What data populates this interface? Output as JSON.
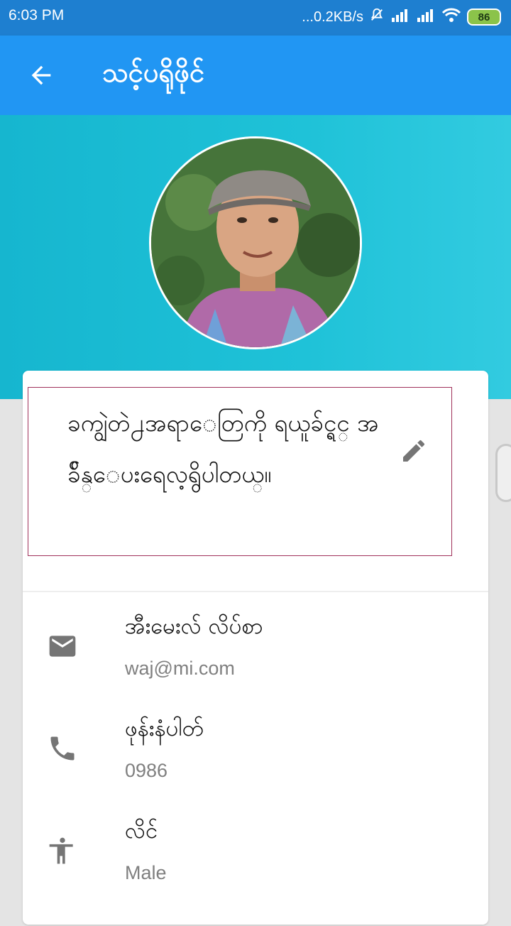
{
  "status_bar": {
    "time": "6:03 PM",
    "net_speed": "...0.2KB/s",
    "battery": "86"
  },
  "app_bar": {
    "title": "သင့်ပရိုဖိုင်"
  },
  "profile": {
    "bio": "ခကျွဲတဲ႕အရာေတြကို ရယူခ်င္ရင္ အခ်ိန္ေပးရေလ့ရွိပါတယ္။"
  },
  "info": {
    "email": {
      "label": "အီးမေးလ် လိပ်စာ",
      "value": "waj@mi.com",
      "icon": "email-icon"
    },
    "phone": {
      "label": "ဖုန်းနံပါတ်",
      "value": "0986",
      "icon": "phone-icon"
    },
    "gender": {
      "label": "လိင်",
      "value": "Male",
      "icon": "person-icon"
    }
  },
  "colors": {
    "app_bar": "#2196f3",
    "status_bar": "#1e7fd0",
    "hero": "#1fc2d8",
    "icon_gray": "#757575"
  }
}
